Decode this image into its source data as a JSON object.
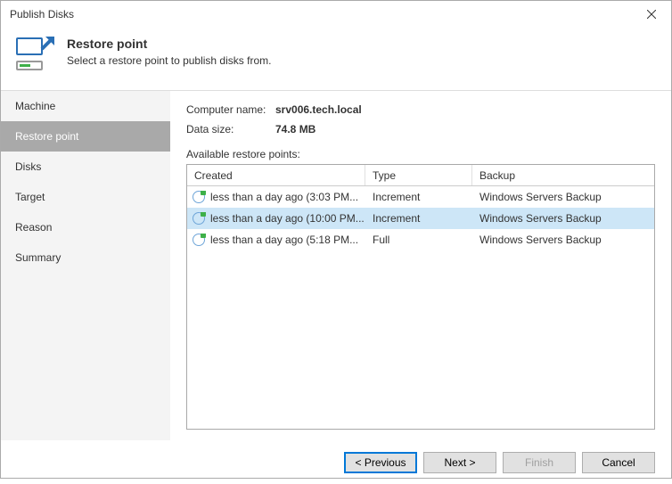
{
  "window": {
    "title": "Publish Disks"
  },
  "header": {
    "title": "Restore point",
    "description": "Select a restore point to publish disks from."
  },
  "sidebar": {
    "items": [
      {
        "label": "Machine"
      },
      {
        "label": "Restore point"
      },
      {
        "label": "Disks"
      },
      {
        "label": "Target"
      },
      {
        "label": "Reason"
      },
      {
        "label": "Summary"
      }
    ],
    "activeIndex": 1
  },
  "main": {
    "computerName": {
      "label": "Computer name:",
      "value": "srv006.tech.local"
    },
    "dataSize": {
      "label": "Data size:",
      "value": "74.8 MB"
    },
    "availableLabel": "Available restore points:",
    "columns": {
      "created": "Created",
      "type": "Type",
      "backup": "Backup"
    },
    "rows": [
      {
        "created": "less than a day ago (3:03 PM...",
        "type": "Increment",
        "backup": "Windows Servers Backup",
        "iconType": "incr"
      },
      {
        "created": "less than a day ago (10:00 PM...",
        "type": "Increment",
        "backup": "Windows Servers Backup",
        "iconType": "incr"
      },
      {
        "created": "less than a day ago (5:18 PM...",
        "type": "Full",
        "backup": "Windows Servers Backup",
        "iconType": "full"
      }
    ],
    "selectedIndex": 1
  },
  "footer": {
    "previous": "< Previous",
    "next": "Next >",
    "finish": "Finish",
    "cancel": "Cancel"
  }
}
